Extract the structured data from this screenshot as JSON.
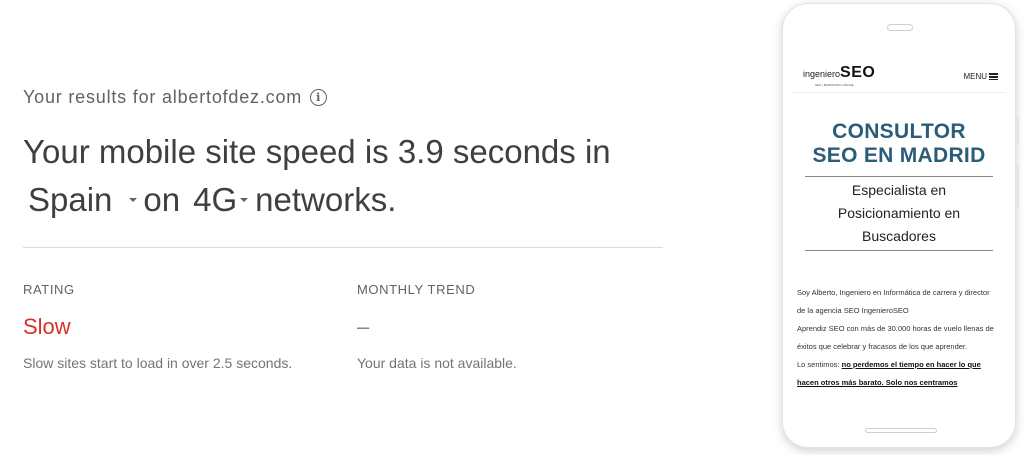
{
  "results": {
    "prefix": "Your results for albertofdez.com",
    "info_icon": "info-icon"
  },
  "headline": {
    "text_before": "Your mobile site speed is 3.9 seconds in",
    "country": "Spain",
    "connector": "on",
    "network": "4G",
    "text_after": "networks."
  },
  "rating": {
    "label": "RATING",
    "value": "Slow",
    "description": "Slow sites start to load in over 2.5 seconds.",
    "color": "#d93025"
  },
  "trend": {
    "label": "MONTHLY TREND",
    "value": "–",
    "description": "Your data is not available."
  },
  "phone": {
    "logo_prefix": "ingeniero",
    "logo_main": "SEO",
    "logo_tagline": "SEO | MARKETING ONLINE",
    "menu_label": "MENU",
    "hero_line1": "CONSULTOR",
    "hero_line2": "SEO EN MADRID",
    "sub_line1": "Especialista en",
    "sub_line2": "Posicionamiento en",
    "sub_line3": "Buscadores",
    "para_1": "Soy Alberto, Ingeniero en Informática de carrera y director de la agencia SEO IngenieroSEO",
    "para_2": "Aprendiz SEO con más de 30.000 horas de vuelo llenas de éxitos que celebrar y fracasos de los que aprender.",
    "para_3_plain": "Lo sentimos: ",
    "para_3_bold": "no perdemos el tiempo en hacer lo que hacen otros más barato. Solo nos centramos",
    "hero_color": "#2c5d78"
  }
}
